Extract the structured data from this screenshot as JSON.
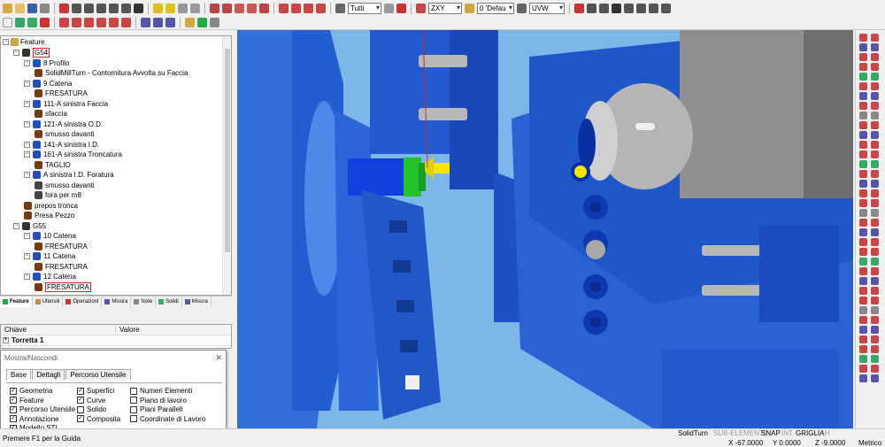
{
  "toolbar": {
    "select_filter": "Tutti",
    "plane": "ZXY",
    "layer": "0 'Defau",
    "coord_system": "UVW"
  },
  "tree": {
    "title": "Feature",
    "nodes": [
      {
        "label": "G54",
        "highlighted": true
      },
      {
        "label": "8 Profilo"
      },
      {
        "label": "SolidMillTurn - Contornitura Avvolta su Faccia"
      },
      {
        "label": "9 Catena"
      },
      {
        "label": "FRESATURA"
      },
      {
        "label": "111-A sinistra Faccia"
      },
      {
        "label": "sfaccia"
      },
      {
        "label": "121-A sinistra O.D."
      },
      {
        "label": "smusso davanti"
      },
      {
        "label": "141-A sinistra I.D."
      },
      {
        "label": "161-A sinistra Troncatura"
      },
      {
        "label": "TAGLIO"
      },
      {
        "label": "A sinistra I.D. Foratura"
      },
      {
        "label": "smusso davanti"
      },
      {
        "label": "fora per m8"
      },
      {
        "label": "prepos tronca"
      },
      {
        "label": "Presa Pezzo"
      },
      {
        "label": "G55"
      },
      {
        "label": "10 Catena"
      },
      {
        "label": "FRESATURA"
      },
      {
        "label": "11 Catena"
      },
      {
        "label": "FRESATURA"
      },
      {
        "label": "12 Catena"
      },
      {
        "label": "FRESATURA",
        "highlighted": true
      }
    ]
  },
  "tabs": [
    "Feature",
    "Utensili",
    "Operazioni",
    "Misura",
    "Note",
    "Solidi",
    "Misura"
  ],
  "properties": {
    "col_key": "Chiave",
    "col_value": "Valore",
    "rows": [
      {
        "key": "Torretta 1",
        "value": ""
      }
    ]
  },
  "dialog": {
    "title": "Mostra/Nascondi",
    "close": "✕",
    "tabs": [
      "Base",
      "Dettagli",
      "Percorso Utensile"
    ],
    "col1": [
      {
        "label": "Geometria",
        "checked": true
      },
      {
        "label": "Feature",
        "checked": true
      },
      {
        "label": "Percorso Utensile",
        "checked": true
      },
      {
        "label": "Annotazione",
        "checked": true
      },
      {
        "label": "Modello STL",
        "checked": true
      }
    ],
    "col2": [
      {
        "label": "Superfici",
        "checked": true
      },
      {
        "label": "Curve",
        "checked": true
      },
      {
        "label": "Solido",
        "checked": false
      },
      {
        "label": "Composita",
        "checked": true
      }
    ],
    "col3": [
      {
        "label": "Numeri Elementi",
        "checked": false
      },
      {
        "label": "Piano di lavoro",
        "checked": false
      },
      {
        "label": "Piani Paralleli",
        "checked": false
      },
      {
        "label": "Coordinate di Lavoro",
        "checked": false
      }
    ]
  },
  "status": {
    "help": "Premere F1 per la Guida",
    "solidturn": "SolidTurn",
    "subelem": "SUB-ELEMENTI",
    "snap": "SNAP",
    "int": "INT",
    "griglia": "GRIGLIA",
    "h": "H",
    "x": "X -67.0000",
    "y": "Y 0.0000",
    "z": "Z -9.0000",
    "units": "Metrico"
  },
  "colors": {
    "viewport_bg": "#7db7e8",
    "blue_part": "#1f5fd0",
    "dark_blue": "#0a2fa0",
    "green_tool": "#22c22a",
    "yellow_tool": "#f4e400",
    "gray_spindle": "#9a9a9a"
  }
}
